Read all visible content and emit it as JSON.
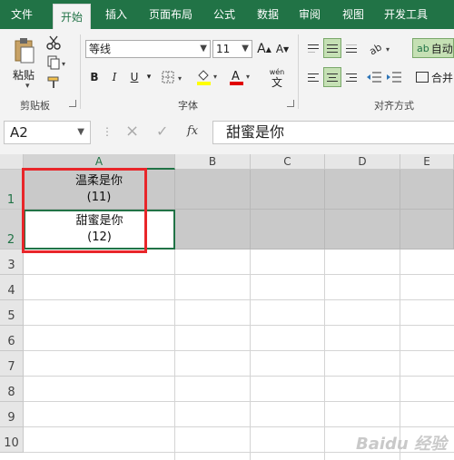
{
  "tabs": [
    "文件",
    "开始",
    "插入",
    "页面布局",
    "公式",
    "数据",
    "审阅",
    "视图",
    "开发工具"
  ],
  "active_tab": "开始",
  "ribbon": {
    "clipboard": {
      "paste_label": "粘贴",
      "group_label": "剪贴板"
    },
    "font": {
      "font_name": "等线",
      "font_size": "11",
      "grow_label": "A",
      "shrink_label": "A",
      "bold": "B",
      "italic": "I",
      "underline": "U",
      "font_color_letter": "A",
      "phonetic_top": "wén",
      "phonetic_bottom": "文",
      "group_label": "字体"
    },
    "alignment": {
      "wrap_label": "自动",
      "merge_label": "合并",
      "group_label": "对齐方式"
    },
    "colors": {
      "accent": "#217346",
      "fill_yellow": "#ffff00",
      "font_red": "#e00000"
    }
  },
  "formula_bar": {
    "name_box": "A2",
    "cancel_icon": "×",
    "enter_icon": "✓",
    "fx": "fx",
    "content": "甜蜜是你"
  },
  "sheet": {
    "columns": [
      "A",
      "B",
      "C",
      "D",
      "E"
    ],
    "rows": [
      "1",
      "2",
      "3",
      "4",
      "5",
      "6",
      "7",
      "8",
      "9",
      "10"
    ],
    "cells": {
      "A1": {
        "line1": "温柔是你",
        "line2": "(11)"
      },
      "A2": {
        "line1": "甜蜜是你",
        "line2": "(12)"
      }
    }
  },
  "watermark": "Baidu 经验"
}
